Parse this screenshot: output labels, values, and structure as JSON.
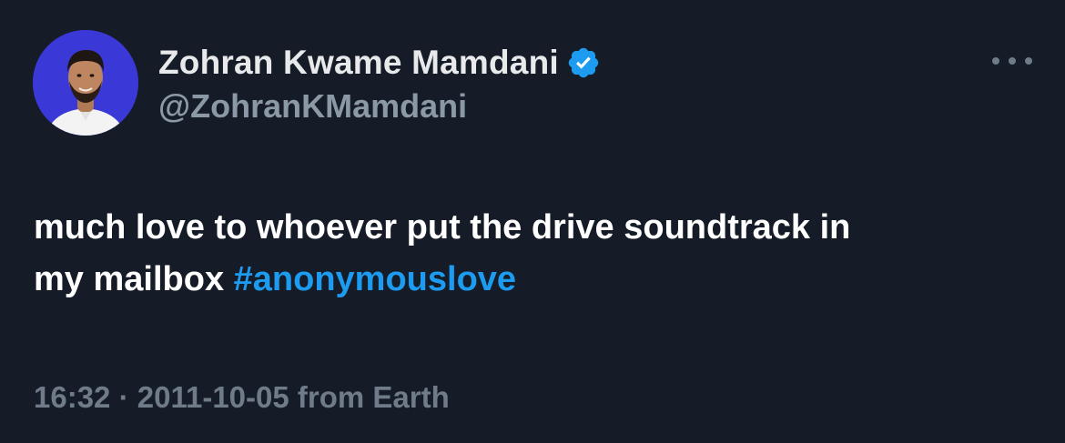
{
  "author": {
    "display_name": "Zohran Kwame Mamdani",
    "handle": "@ZohranKMamdani",
    "verified_icon": "verified-badge-icon",
    "avatar": "avatar-photo"
  },
  "menu": {
    "more_icon": "more-options-icon"
  },
  "tweet": {
    "text_line1": "much love to whoever put the drive soundtrack in",
    "text_line2": "my mailbox ",
    "hashtag": "#anonymouslove",
    "time": "16:32",
    "separator": "·",
    "date": "2011-10-05",
    "source": "from Earth"
  },
  "colors": {
    "background": "#151c27",
    "text": "#ffffff",
    "secondary": "#8b98a5",
    "link": "#1d9bf0",
    "verified": "#1d9bf0",
    "avatar_bg": "#3a38d6"
  }
}
